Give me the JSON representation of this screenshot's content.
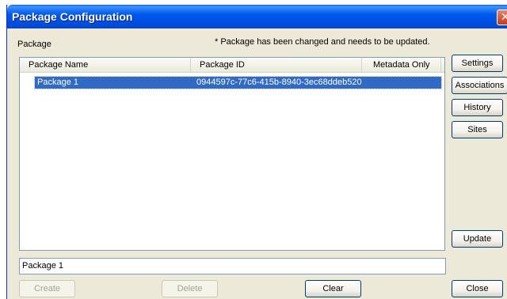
{
  "window": {
    "title": "Package Configuration"
  },
  "header": {
    "package_label": "Package",
    "notice": "* Package has been changed and needs to be updated."
  },
  "list": {
    "columns": [
      "Package Name",
      "Package ID",
      "Metadata Only"
    ],
    "rows": [
      {
        "name": "Package 1",
        "id": "0944597c-77c6-415b-8940-3ec68ddeb520",
        "metadata_only": ""
      }
    ]
  },
  "side_buttons": {
    "settings": "Settings",
    "associations": "Associations",
    "history": "History",
    "sites": "Sites",
    "update": "Update"
  },
  "name_field": {
    "value": "Package 1"
  },
  "bottom_buttons": {
    "create": "Create",
    "delete": "Delete",
    "clear": "Clear",
    "close": "Close"
  },
  "colors": {
    "titlebar": "#0058ee",
    "selection": "#316ac5",
    "dialog": "#ece9d8"
  }
}
